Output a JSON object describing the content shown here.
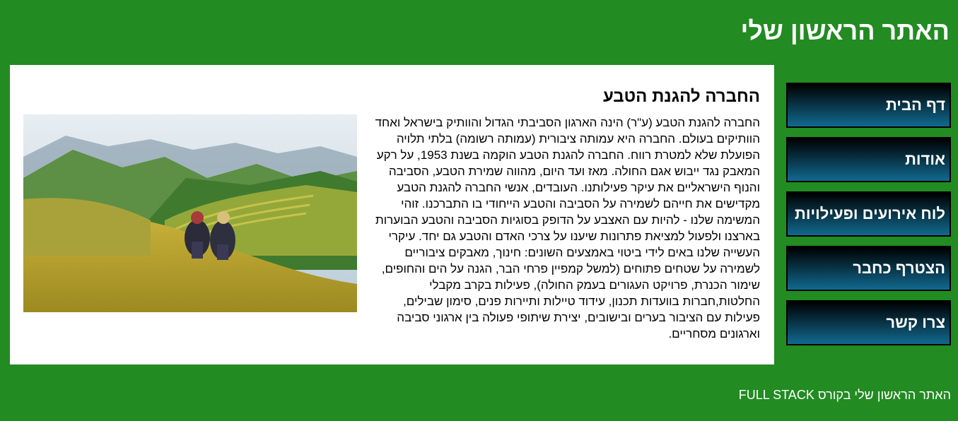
{
  "header": {
    "title": "האתר הראשון שלי"
  },
  "nav": {
    "items": [
      {
        "label": "דף הבית"
      },
      {
        "label": "אודות"
      },
      {
        "label": "לוח אירועים ופעילויות"
      },
      {
        "label": "הצטרף כחבר"
      },
      {
        "label": "צרו קשר"
      }
    ]
  },
  "main": {
    "title": "החברה להגנת הטבע",
    "body": "החברה להגנת הטבע (ע\"ר) הינה הארגון הסביבתי הגדול והוותיק בישראל ואחד הוותיקים בעולם. החברה היא עמותה ציבורית (עמותה רשומה) בלתי תלויה הפועלת שלא למטרת רווח. החברה להגנת הטבע הוקמה בשנת 1953, על רקע המאבק נגד ייבוש אגם החולה. מאז ועד היום, מהווה שמירת הטבע, הסביבה והנוף הישראליים את עיקר פעילותנו. העובדים, אנשי החברה להגנת הטבע מקדישים את חייהם לשמירה על הסביבה והטבע הייחודי בו התברכנו. זוהי המשימה שלנו - להיות עם האצבע על הדופק בסוגיות הסביבה והטבע הבוערות בארצנו ולפעול למציאת פתרונות שיענו על צרכי האדם והטבע גם יחד. עיקרי העשייה שלנו באים לידי ביטוי באמצעים השונים: חינוך, מאבקים ציבוריים לשמירה על שטחים פתוחים (למשל קמפיין פרחי הבר, הגנה על הים והחופים, שימור הכנרת, פרויקט העגורים בעמק החולה), פעילות בקרב מקבלי החלטות,חברות בוועדות תכנון, עידוד טיילות ותיירות פנים, סימון שבילים, פעילות עם הציבור בערים ובישובים, יצירת שיתופי פעולה בין ארגוני סביבה וארגונים מסחריים."
  },
  "footer": {
    "text": "האתר הראשון שלי בקורס FULL STACK"
  },
  "colors": {
    "page_bg": "#228b22",
    "nav_gradient_top": "#000000",
    "nav_gradient_bottom": "#11698f",
    "content_bg": "#ffffff"
  },
  "icons": {
    "photo": "rice-terraces-photo"
  }
}
